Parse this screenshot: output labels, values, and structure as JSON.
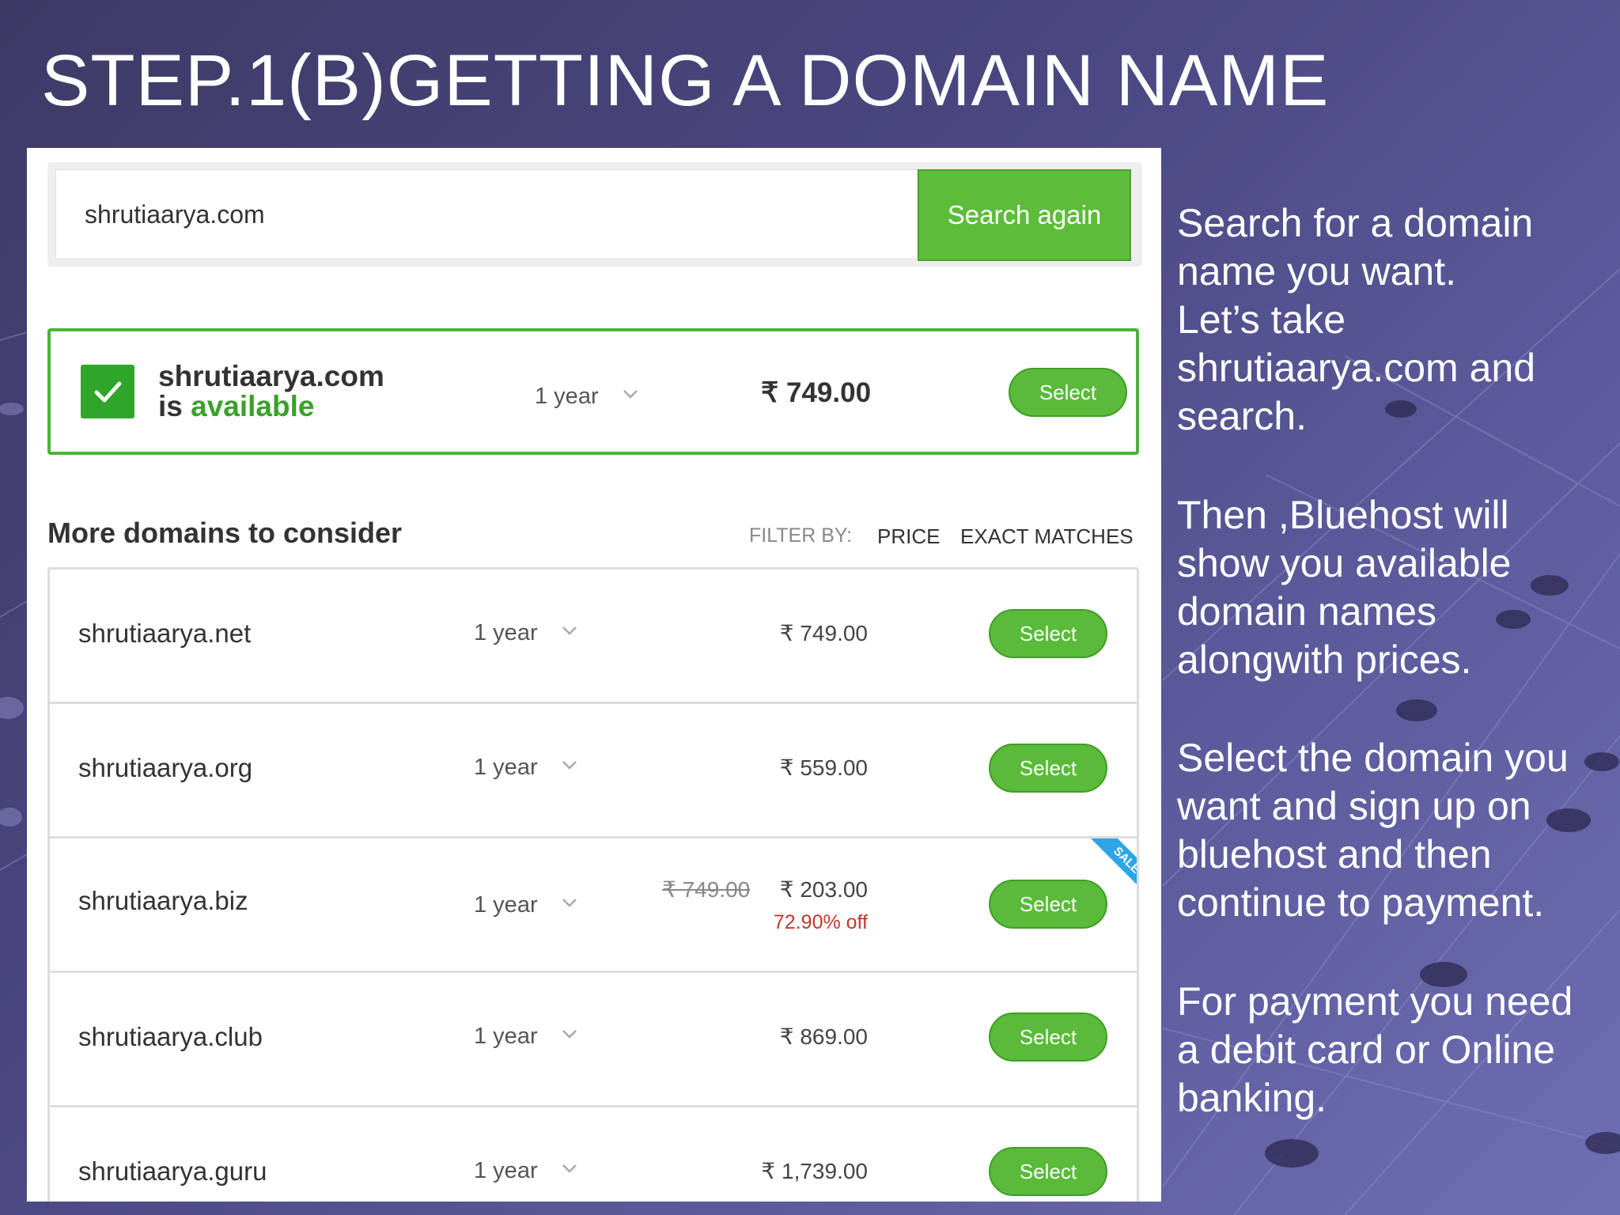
{
  "slide": {
    "title": "STEP.1(B)GETTING A DOMAIN NAME"
  },
  "search": {
    "value": "shrutiaarya.com",
    "button_label": "Search again"
  },
  "availability": {
    "domain": "shrutiaarya.com",
    "status_prefix": "is ",
    "status_word": "available",
    "term": "1 year",
    "price": "₹ 749.00",
    "select_label": "Select"
  },
  "more": {
    "heading": "More domains to consider",
    "filter_label": "FILTER BY:",
    "filter_price": "PRICE",
    "filter_exact": "EXACT MATCHES"
  },
  "rows": [
    {
      "domain": "shrutiaarya.net",
      "term": "1 year",
      "price": "₹ 749.00",
      "select_label": "Select"
    },
    {
      "domain": "shrutiaarya.org",
      "term": "1 year",
      "price": "₹ 559.00",
      "select_label": "Select"
    },
    {
      "domain": "shrutiaarya.biz",
      "term": "1 year",
      "old_price": "₹ 749.00",
      "price": "₹ 203.00",
      "discount": "72.90% off",
      "badge": "SALE",
      "select_label": "Select"
    },
    {
      "domain": "shrutiaarya.club",
      "term": "1 year",
      "price": "₹ 869.00",
      "select_label": "Select"
    },
    {
      "domain": "shrutiaarya.guru",
      "term": "1 year",
      "price": "₹ 1,739.00",
      "select_label": "Select"
    }
  ],
  "instructions": [
    {
      "lines": [
        "Search for a domain",
        "name you want.",
        "Let’s take",
        "shrutiaarya.com and",
        "search."
      ]
    },
    {
      "lines": [
        "Then ,Bluehost will",
        "show you available",
        "domain names",
        "alongwith prices."
      ]
    },
    {
      "lines": [
        "Select the domain you",
        "want and sign up on",
        "bluehost and then",
        "continue to payment."
      ]
    },
    {
      "lines": [
        "For payment you need",
        "a debit card or Online",
        "banking."
      ]
    }
  ],
  "colors": {
    "background": "#4a4781",
    "select_button": "#59bb39",
    "available_text": "#3aa12a",
    "discount_text": "#c0392b",
    "sale_badge": "#2da5e6"
  }
}
